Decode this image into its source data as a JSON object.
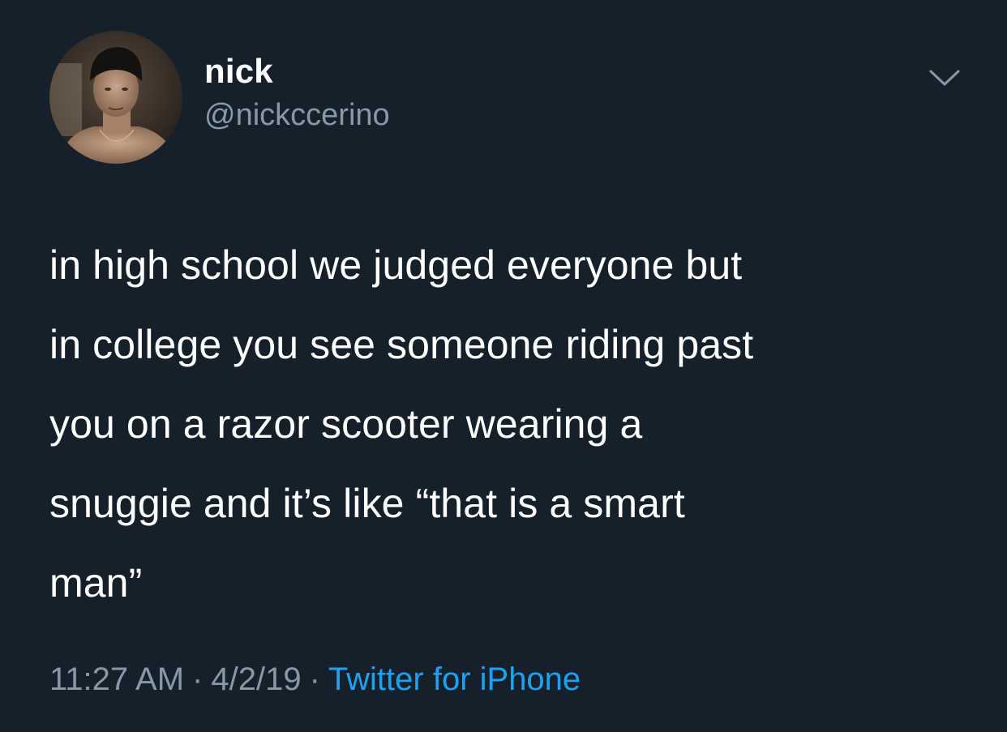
{
  "author": {
    "display_name": "nick",
    "handle": "@nickccerino",
    "avatar_icon": "profile-photo"
  },
  "menu": {
    "icon": "chevron-down-icon"
  },
  "tweet": {
    "lines": [
      "in high school we judged everyone but",
      "in college you see someone riding past",
      "you on a razor scooter wearing a",
      "snuggie and it’s like “that is a smart",
      "man”"
    ]
  },
  "meta": {
    "time": "11:27 AM",
    "separator": "·",
    "date": "4/2/19",
    "source": "Twitter for iPhone"
  },
  "colors": {
    "background": "#15202b",
    "secondary_text": "#8899a6",
    "link": "#1da1f2"
  }
}
